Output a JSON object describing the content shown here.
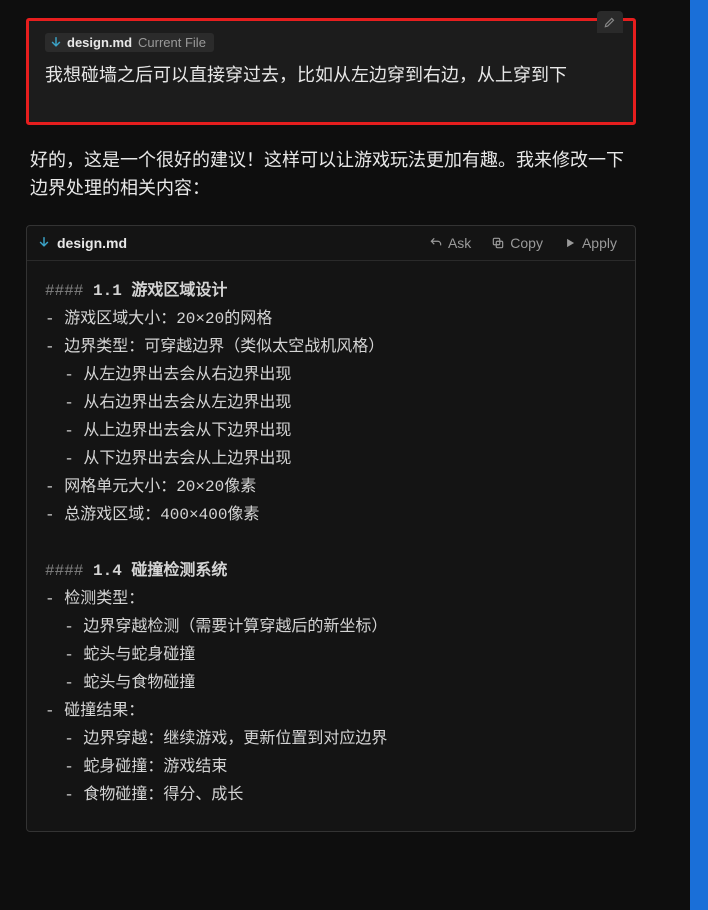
{
  "user_block": {
    "file_chip": {
      "icon": "arrow-down",
      "name": "design.md",
      "suffix": "Current File"
    },
    "message": "我想碰墙之后可以直接穿过去，比如从左边穿到右边，从上穿到下"
  },
  "assistant_intro": "好的，这是一个很好的建议！这样可以让游戏玩法更加有趣。我来修改一下边界处理的相关内容：",
  "code_card": {
    "file": "design.md",
    "actions": {
      "ask": "Ask",
      "copy": "Copy",
      "apply": "Apply"
    },
    "sections": [
      {
        "heading_prefix": "####",
        "heading": "1.1 游戏区域设计",
        "lines": [
          "- 游戏区域大小：20×20的网格",
          "- 边界类型：可穿越边界（类似太空战机风格）",
          "  - 从左边界出去会从右边界出现",
          "  - 从右边界出去会从左边界出现",
          "  - 从上边界出去会从下边界出现",
          "  - 从下边界出去会从上边界出现",
          "- 网格单元大小：20×20像素",
          "- 总游戏区域：400×400像素"
        ]
      },
      {
        "heading_prefix": "####",
        "heading": "1.4 碰撞检测系统",
        "lines": [
          "- 检测类型：",
          "  - 边界穿越检测（需要计算穿越后的新坐标）",
          "  - 蛇头与蛇身碰撞",
          "  - 蛇头与食物碰撞",
          "- 碰撞结果：",
          "  - 边界穿越：继续游戏，更新位置到对应边界",
          "  - 蛇身碰撞：游戏结束",
          "  - 食物碰撞：得分、成长"
        ]
      }
    ]
  }
}
